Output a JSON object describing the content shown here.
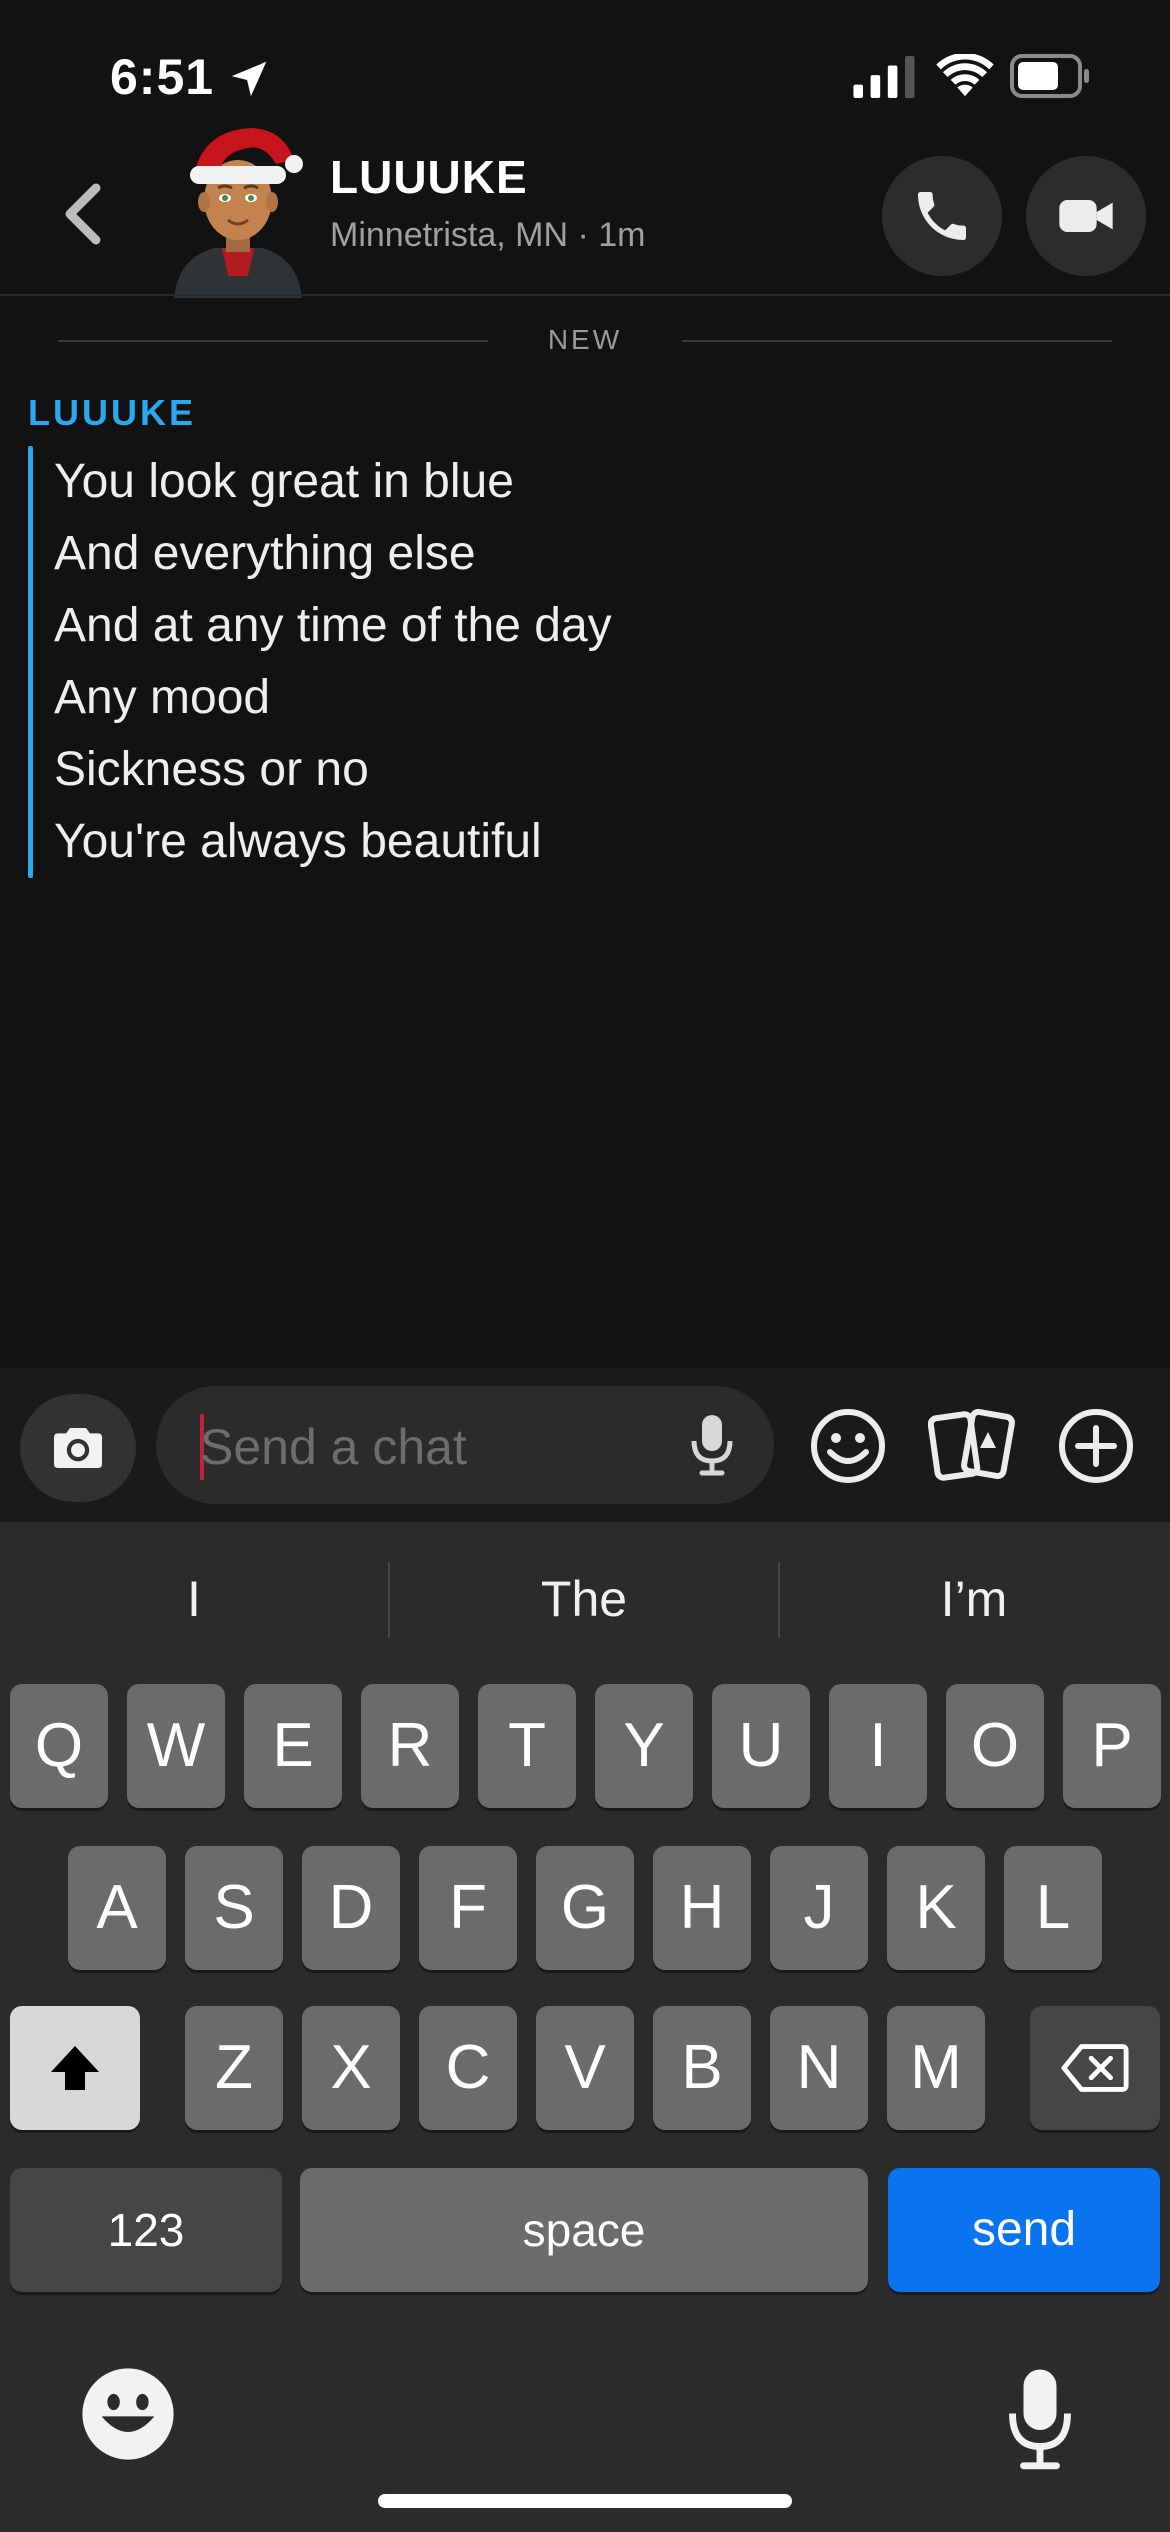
{
  "status_bar": {
    "time": "6:51"
  },
  "header": {
    "contact_name": "LUUUKE",
    "contact_subtitle": "Minnetrista, MN · 1m"
  },
  "divider_label": "NEW",
  "message": {
    "sender": "LUUUKE",
    "lines": [
      "You look great in blue",
      "And everything else",
      "And at any time of the day",
      "Any mood",
      "Sickness or no",
      "You're always beautiful"
    ]
  },
  "composer": {
    "placeholder": "Send a chat"
  },
  "keyboard": {
    "suggestions": [
      "I",
      "The",
      "I’m"
    ],
    "row1": [
      "Q",
      "W",
      "E",
      "R",
      "T",
      "Y",
      "U",
      "I",
      "O",
      "P"
    ],
    "row2": [
      "A",
      "S",
      "D",
      "F",
      "G",
      "H",
      "J",
      "K",
      "L"
    ],
    "row3": [
      "Z",
      "X",
      "C",
      "V",
      "B",
      "N",
      "M"
    ],
    "numbers_label": "123",
    "space_label": "space",
    "send_label": "send"
  },
  "colors": {
    "accent": "#2aa8f0",
    "send_key": "#0a74f0",
    "caret": "#c0223a"
  }
}
